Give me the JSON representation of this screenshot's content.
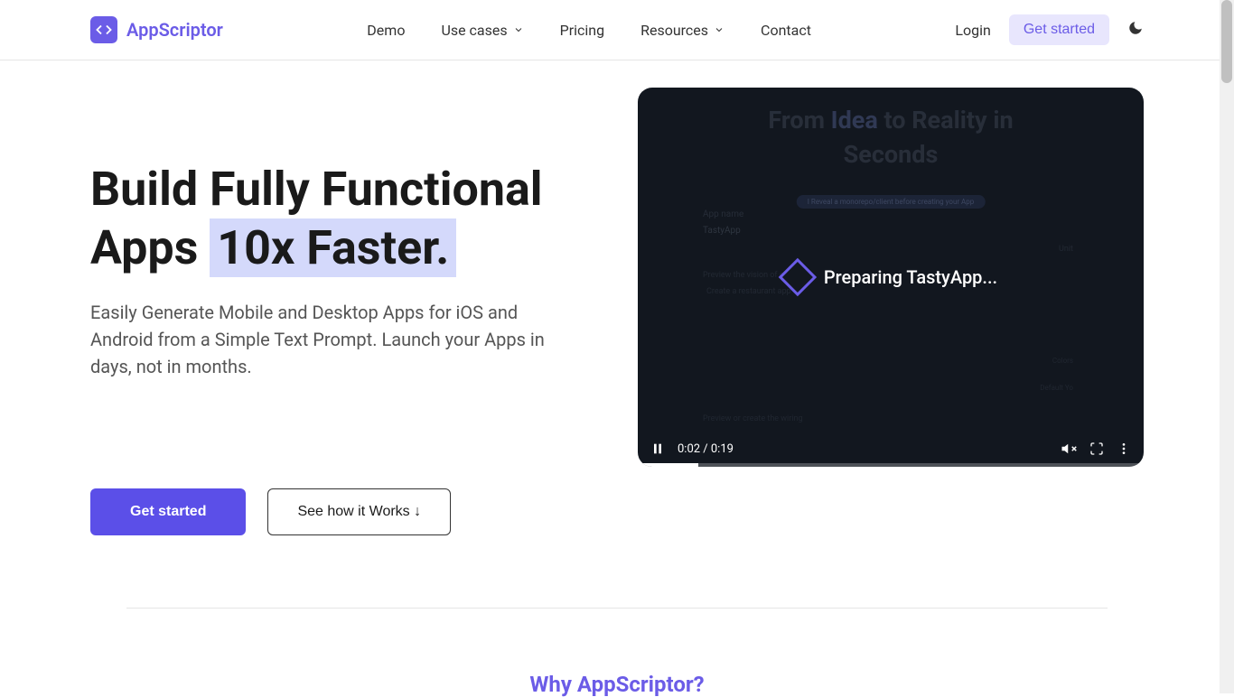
{
  "brand": {
    "name": "AppScriptor",
    "accent_color": "#6B5CE7"
  },
  "nav": {
    "items": [
      {
        "label": "Demo",
        "has_dropdown": false
      },
      {
        "label": "Use cases",
        "has_dropdown": true
      },
      {
        "label": "Pricing",
        "has_dropdown": false
      },
      {
        "label": "Resources",
        "has_dropdown": true
      },
      {
        "label": "Contact",
        "has_dropdown": false
      }
    ]
  },
  "header_actions": {
    "login": "Login",
    "get_started": "Get started"
  },
  "hero": {
    "title_line1": "Build Fully Functional",
    "title_line2_pre": "Apps ",
    "title_line2_highlight": "10x Faster.",
    "subtitle": "Easily Generate Mobile and Desktop Apps for iOS and Android from a Simple Text Prompt. Launch your Apps in days, not in months.",
    "cta_primary": "Get started",
    "cta_secondary": "See how it Works ↓"
  },
  "video": {
    "bg_title_pre": "From ",
    "bg_title_idea": "Idea",
    "bg_title_mid": " to Reality in",
    "bg_title_line2": "Seconds",
    "pill": "I  Reveal a monorepo/client before creating your App",
    "label_appname": "App name",
    "input_appname": "TastyApp",
    "unit": "Unit",
    "label_describe": "Preview   the vision of e",
    "content_describe": "Create a restaurant app",
    "side1": "Colors",
    "side2": "Default   Yo",
    "bottom_text": "Preview or create the wiring",
    "overlay_text": "Preparing TastyApp...",
    "time": "0:02 / 0:19"
  },
  "section2": {
    "title": "Why AppScriptor?"
  }
}
